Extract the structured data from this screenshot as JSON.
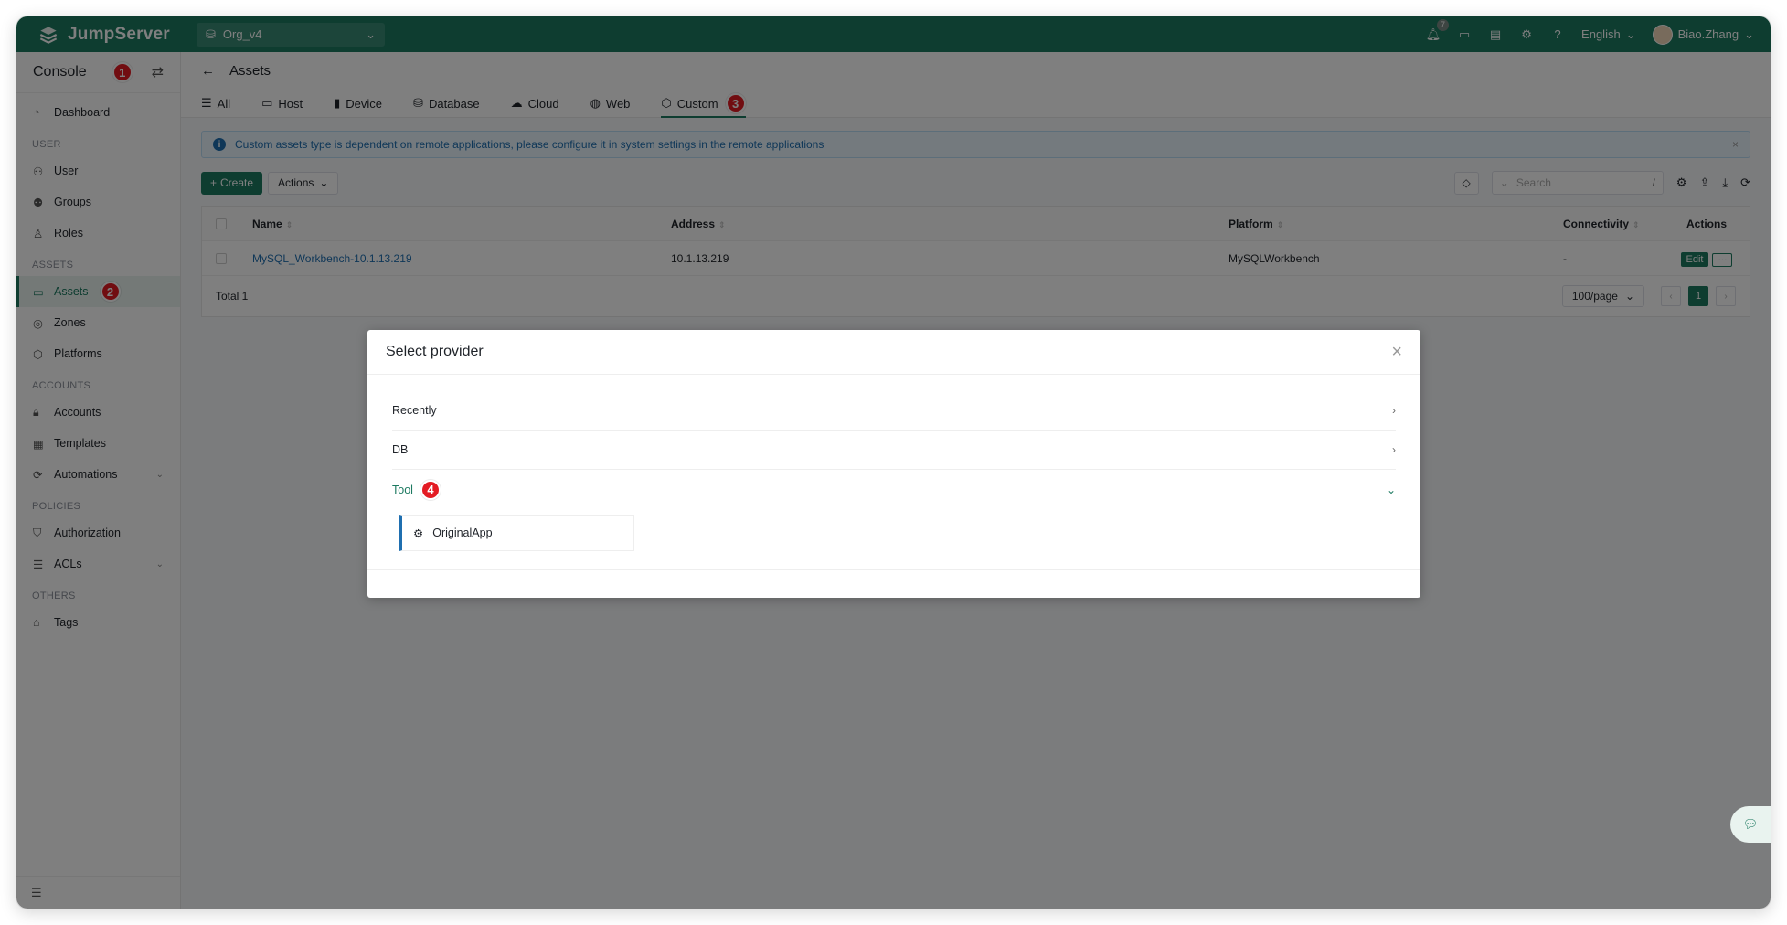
{
  "topbar": {
    "brand": "JumpServer",
    "org": "Org_v4",
    "notification_count": "7",
    "language": "English",
    "username": "Biao.Zhang"
  },
  "sidebar": {
    "title": "Console",
    "dashboard": "Dashboard",
    "sections": {
      "user": "USER",
      "assets": "ASSETS",
      "accounts": "ACCOUNTS",
      "policies": "POLICIES",
      "others": "OTHERS"
    },
    "items": {
      "user": "User",
      "groups": "Groups",
      "roles": "Roles",
      "assets": "Assets",
      "zones": "Zones",
      "platforms": "Platforms",
      "accounts": "Accounts",
      "templates": "Templates",
      "automations": "Automations",
      "authorization": "Authorization",
      "acls": "ACLs",
      "tags": "Tags"
    }
  },
  "page": {
    "title": "Assets",
    "tabs": [
      "All",
      "Host",
      "Device",
      "Database",
      "Cloud",
      "Web",
      "Custom"
    ],
    "active_tab": "Custom",
    "alert": "Custom assets type is dependent on remote applications, please configure it in system settings in the remote applications",
    "create_label": "Create",
    "actions_label": "Actions",
    "search_placeholder": "Search",
    "search_shortcut": "/",
    "columns": {
      "name": "Name",
      "address": "Address",
      "platform": "Platform",
      "connectivity": "Connectivity",
      "actions": "Actions"
    },
    "rows": [
      {
        "name": "MySQL_Workbench-10.1.13.219",
        "address": "10.1.13.219",
        "platform": "MySQLWorkbench",
        "connectivity": "-",
        "edit": "Edit",
        "more": "···"
      }
    ],
    "total": "Total 1",
    "page_size": "100/page",
    "current_page": "1"
  },
  "modal": {
    "title": "Select provider",
    "groups": {
      "recently": "Recently",
      "db": "DB",
      "tool": "Tool"
    },
    "provider": "OriginalApp"
  },
  "annotations": {
    "n1": "1",
    "n2": "2",
    "n3": "3",
    "n4": "4"
  },
  "colors": {
    "brand": "#1d7a61",
    "link": "#1f6fb0",
    "annotation": "#e31b23"
  }
}
